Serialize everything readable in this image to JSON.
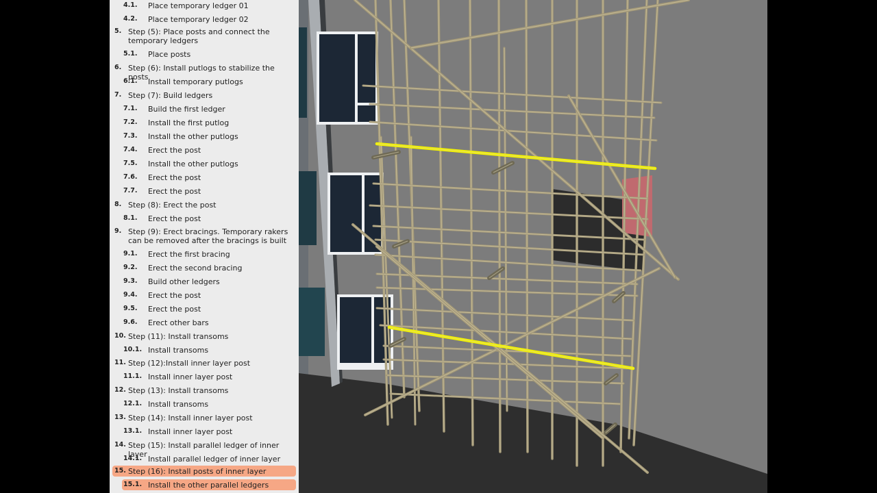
{
  "steps": [
    {
      "num": "4.1.",
      "label": "Place temporary ledger 01",
      "level": "sub"
    },
    {
      "num": "4.2.",
      "label": "Place temporary ledger 02",
      "level": "sub"
    },
    {
      "num": "5.",
      "label": "Step (5): Place posts and connect the temporary ledgers",
      "level": "main"
    },
    {
      "num": "5.1.",
      "label": "Place posts",
      "level": "sub"
    },
    {
      "num": "6.",
      "label": "Step (6): Install putlogs to stabilize the posts",
      "level": "main"
    },
    {
      "num": "6.1.",
      "label": "Install temporary putlogs",
      "level": "sub"
    },
    {
      "num": "7.",
      "label": "Step (7): Build ledgers",
      "level": "main"
    },
    {
      "num": "7.1.",
      "label": "Build the first ledger",
      "level": "sub"
    },
    {
      "num": "7.2.",
      "label": "Install the first putlog",
      "level": "sub"
    },
    {
      "num": "7.3.",
      "label": "Install the other putlogs",
      "level": "sub"
    },
    {
      "num": "7.4.",
      "label": "Erect the post",
      "level": "sub"
    },
    {
      "num": "7.5.",
      "label": "Install the other putlogs",
      "level": "sub"
    },
    {
      "num": "7.6.",
      "label": "Erect the post",
      "level": "sub"
    },
    {
      "num": "7.7.",
      "label": "Erect the post",
      "level": "sub"
    },
    {
      "num": "8.",
      "label": "Step (8): Erect the post",
      "level": "main"
    },
    {
      "num": "8.1.",
      "label": "Erect the post",
      "level": "sub"
    },
    {
      "num": "9.",
      "label": "Step (9): Erect bracings. Temporary rakers can be removed after the bracings is built",
      "level": "main"
    },
    {
      "num": "9.1.",
      "label": "Erect the first bracing",
      "level": "sub"
    },
    {
      "num": "9.2.",
      "label": "Erect the second bracing",
      "level": "sub"
    },
    {
      "num": "9.3.",
      "label": "Build other ledgers",
      "level": "sub"
    },
    {
      "num": "9.4.",
      "label": "Erect the post",
      "level": "sub"
    },
    {
      "num": "9.5.",
      "label": "Erect the post",
      "level": "sub"
    },
    {
      "num": "9.6.",
      "label": "Erect other bars",
      "level": "sub"
    },
    {
      "num": "10.",
      "label": "Step (11): Install transoms",
      "level": "main"
    },
    {
      "num": "10.1.",
      "label": "Install transoms",
      "level": "sub"
    },
    {
      "num": "11.",
      "label": "Step (12):Install inner layer post",
      "level": "main"
    },
    {
      "num": "11.1.",
      "label": "Install inner layer post",
      "level": "sub"
    },
    {
      "num": "12.",
      "label": "Step (13): Install transoms",
      "level": "main"
    },
    {
      "num": "12.1.",
      "label": "Install transoms",
      "level": "sub"
    },
    {
      "num": "13.",
      "label": "Step (14): Install inner layer post",
      "level": "main"
    },
    {
      "num": "13.1.",
      "label": "Install inner layer post",
      "level": "sub"
    },
    {
      "num": "14.",
      "label": "Step (15): Install parallel ledger of inner layer",
      "level": "main"
    },
    {
      "num": "14.1.",
      "label": "Install parallel ledger of inner layer",
      "level": "sub"
    },
    {
      "num": "15.",
      "label": "Step (16): Install posts of inner layer",
      "level": "main",
      "highlight": true
    },
    {
      "num": "15.1.",
      "label": "Install the other parallel ledgers",
      "level": "sub",
      "highlight": true
    }
  ],
  "colors": {
    "highlight": "#f6a785",
    "sidebar_bg": "#ececec",
    "bamboo": "#a59a78",
    "ledger_highlight": "#f2f200",
    "wall": "#7c7c7c",
    "ground": "#2e2e2e"
  }
}
